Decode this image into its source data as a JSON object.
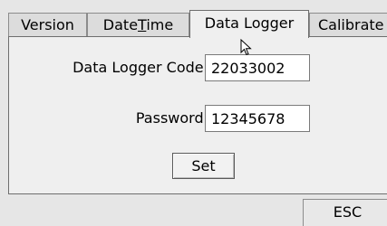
{
  "tabs": [
    {
      "label": "Version"
    },
    {
      "label": "DateTime",
      "mnemonic_letter": "T"
    },
    {
      "label": "Data Logger",
      "active": true
    },
    {
      "label": "Calibrate"
    }
  ],
  "form": {
    "code_label": "Data Logger Code:",
    "code_value": "22033002",
    "password_label": "Password:",
    "password_value": "12345678",
    "set_label": "Set"
  },
  "footer": {
    "esc_label": "ESC"
  },
  "cursor_icon": "arrow-pointer-icon",
  "colors": {
    "window_bg": "#e6e6e6",
    "panel_bg": "#efefef",
    "input_bg": "#ffffff",
    "border": "#6e6e6e"
  }
}
